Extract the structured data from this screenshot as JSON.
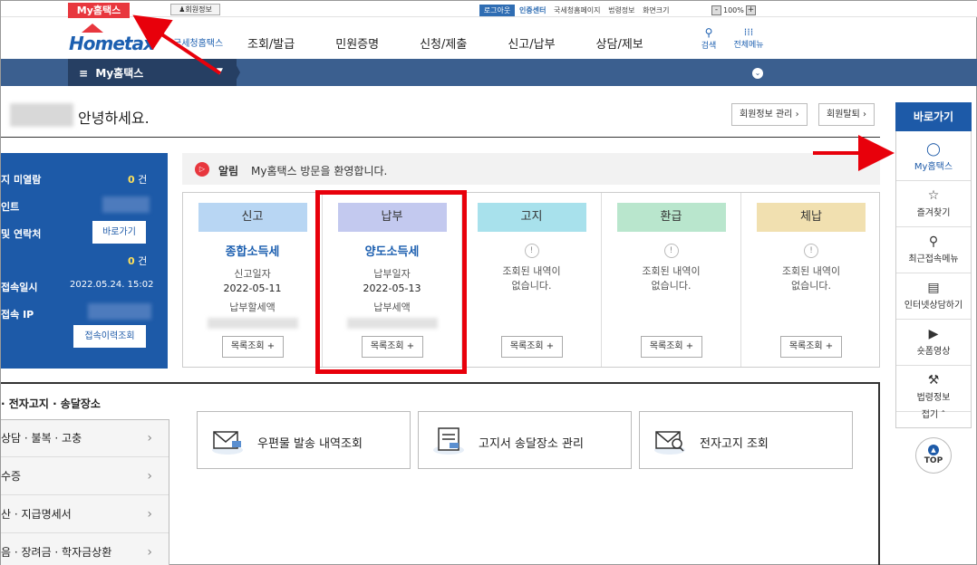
{
  "topbar": {
    "myhome_tab": "My홈택스",
    "member_info": "회원정보",
    "logout": "로그아웃",
    "links": [
      "인증센터",
      "국세청홈페이지",
      "법령정보",
      "화면크기"
    ],
    "zoom_value": "100%",
    "zoom_minus": "-",
    "zoom_plus": "+"
  },
  "header": {
    "logo": "Hometax",
    "logo_sub": "국세청홈택스",
    "gnb": [
      "조회/발급",
      "민원증명",
      "신청/제출",
      "신고/납부",
      "상담/제보"
    ],
    "search_label": "검색",
    "menu_label": "전체메뉴"
  },
  "nav": {
    "label": "My홈택스"
  },
  "greeting": {
    "text": "안녕하세요.",
    "btn_member_manage": "회원정보 관리",
    "btn_withdraw": "회원탈퇴"
  },
  "left_panel": {
    "row1_label": "지 미열람",
    "row1_value": "0",
    "row1_unit": "건",
    "row2_label": "인트",
    "row3_label": "및 연락처",
    "row3_btn": "바로가기",
    "row4_value": "0",
    "row4_unit": "건",
    "row5_label": "접속일시",
    "row5_value": "2022.05.24.  15:02",
    "row6_label": "접속 IP",
    "row6_btn": "접속이력조회"
  },
  "notice": {
    "label": "알림",
    "text": "My홈택스 방문을 환영합니다."
  },
  "status": {
    "cols": [
      {
        "header": "신고",
        "color": "#b8d6f3",
        "title": "종합소득세",
        "sub": "신고일자",
        "date": "2022-05-11",
        "sub2": "납부할세액",
        "btn": "목록조회 +"
      },
      {
        "header": "납부",
        "color": "#c3c9ef",
        "title": "양도소득세",
        "sub": "납부일자",
        "date": "2022-05-13",
        "sub2": "납부세액",
        "btn": "목록조회 +"
      },
      {
        "header": "고지",
        "color": "#a8e1ec",
        "empty1": "조회된 내역이",
        "empty2": "없습니다.",
        "btn": "목록조회 +"
      },
      {
        "header": "환급",
        "color": "#b9e6cd",
        "empty1": "조회된 내역이",
        "empty2": "없습니다.",
        "btn": "목록조회 +"
      },
      {
        "header": "체납",
        "color": "#f1e0b0",
        "empty1": "조회된 내역이",
        "empty2": "없습니다.",
        "btn": "목록조회 +"
      }
    ],
    "warn_symbol": "!"
  },
  "bottom": {
    "title": "· 전자고지 · 송달장소",
    "list": [
      "상담 · 불복 · 고충",
      "수증",
      "산 · 지급명세서",
      "음 · 장려금 · 학자금상환"
    ],
    "cards": [
      "우편물 발송 내역조회",
      "고지서 송달장소 관리",
      "전자고지 조회"
    ]
  },
  "quick_menu": {
    "header": "바로가기",
    "items": [
      {
        "label": "My홈택스",
        "icon": "person-icon"
      },
      {
        "label": "즐겨찾기",
        "icon": "star-icon"
      },
      {
        "label": "최근접속메뉴",
        "icon": "recent-search-icon"
      },
      {
        "label": "인터넷상담하기",
        "icon": "laptop-icon"
      },
      {
        "label": "숏폼영상",
        "icon": "play-icon"
      },
      {
        "label": "법령정보",
        "icon": "gavel-icon"
      }
    ],
    "fold": "접기",
    "top": "TOP"
  },
  "colors": {
    "brand_blue": "#1d5aa8",
    "accent_red": "#e8373e",
    "nav_blue": "#3b5f8f"
  }
}
